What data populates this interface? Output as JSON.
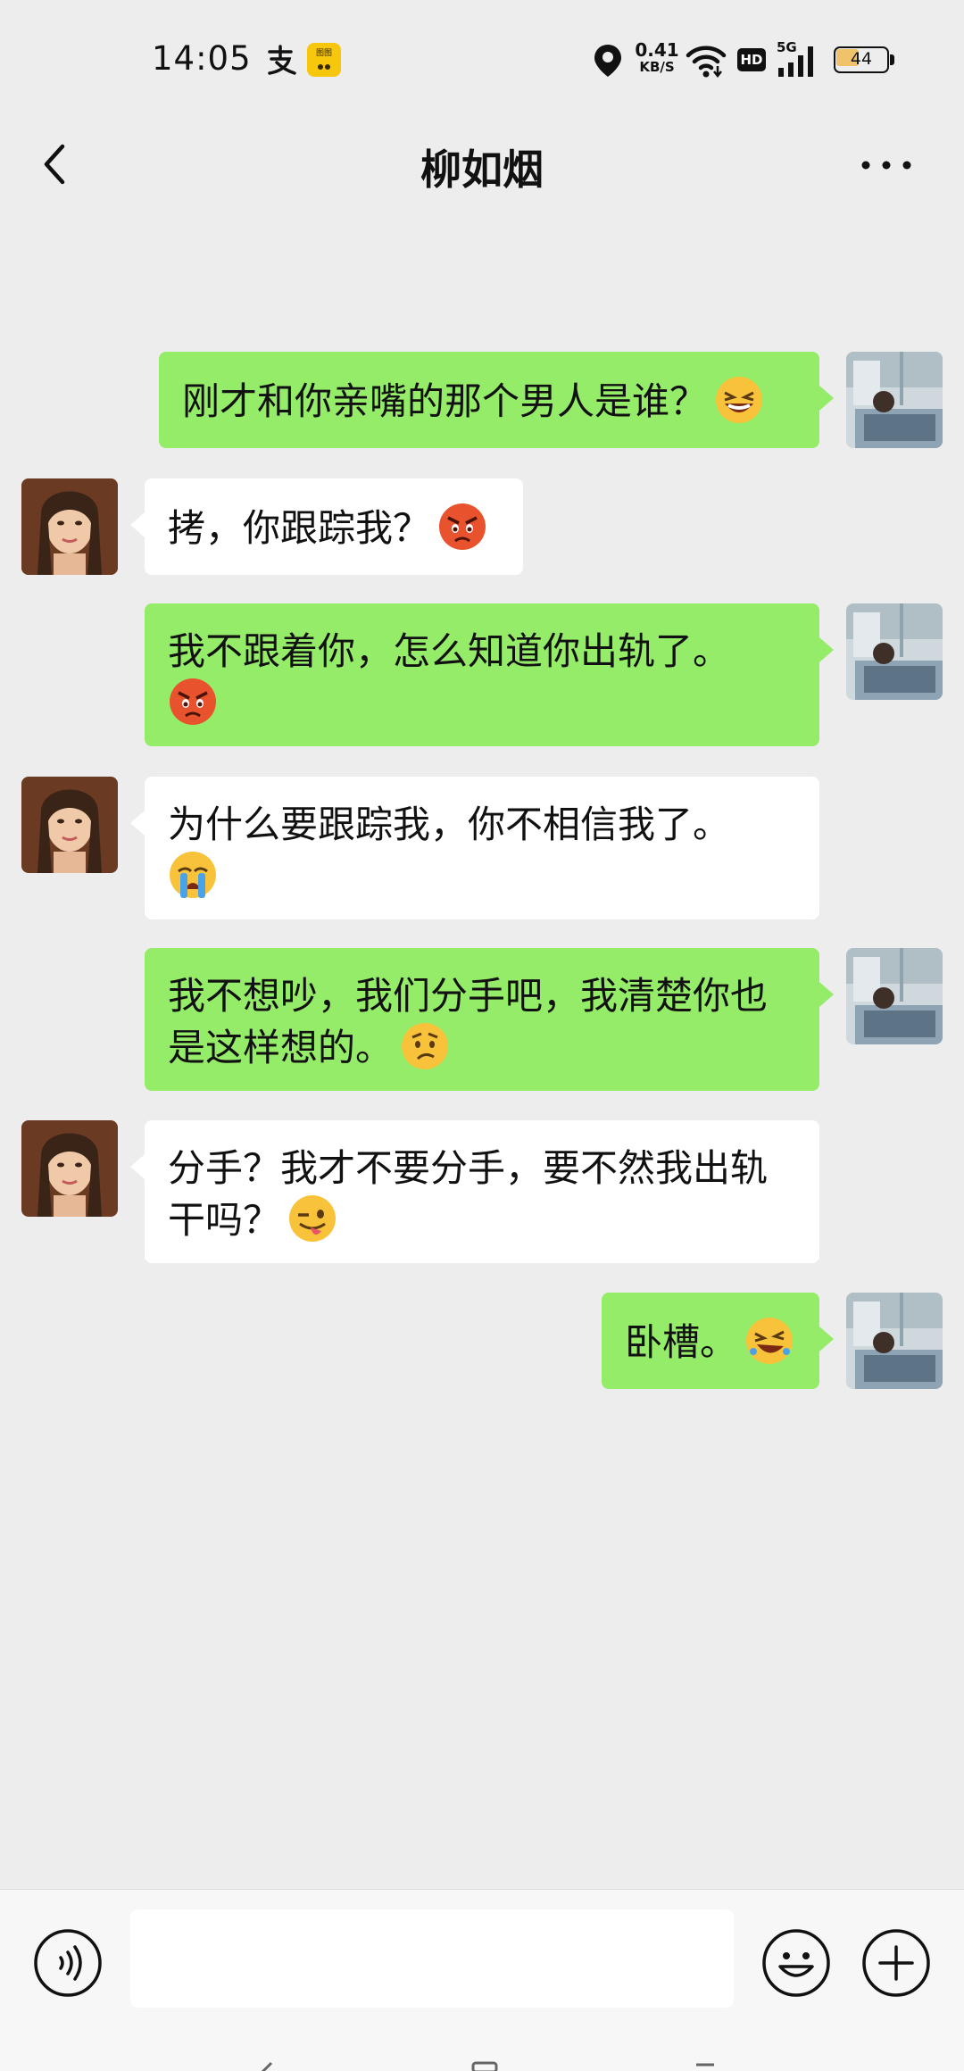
{
  "status_bar": {
    "time": "14:05",
    "app_badge_text": "图图",
    "net_speed_value": "0.41",
    "net_speed_unit": "KB/S",
    "hd_label": "HD",
    "signal_label": "5G",
    "battery_level": "44",
    "battery_fraction": 0.44,
    "icons": [
      "alipay-icon",
      "app-badge-icon",
      "location-icon",
      "wifi-icon",
      "hd-icon",
      "signal-icon",
      "battery-icon"
    ]
  },
  "header": {
    "title": "柳如烟",
    "icons": [
      "back-icon",
      "more-icon"
    ]
  },
  "messages": [
    {
      "side": "out",
      "text": "刚才和你亲嘴的那个男人是谁？",
      "emoji": "grinning-squint-emoji"
    },
    {
      "side": "in",
      "text": "拷，你跟踪我？",
      "emoji": "angry-emoji"
    },
    {
      "side": "out",
      "text": "我不跟着你，怎么知道你出轨了。",
      "emoji": "angry-emoji"
    },
    {
      "side": "in",
      "text": "为什么要跟踪我，你不相信我了。",
      "emoji": "crying-emoji"
    },
    {
      "side": "out",
      "text": "我不想吵，我们分手吧，我清楚你也是这样想的。",
      "emoji": "confused-emoji"
    },
    {
      "side": "in",
      "text": "分手？我才不要分手，要不然我出轨干吗？",
      "emoji": "wink-tongue-emoji"
    },
    {
      "side": "out",
      "text": "卧槽。",
      "emoji": "laughing-emoji"
    }
  ],
  "input_bar": {
    "placeholder": "",
    "icons": [
      "voice-icon",
      "emoji-icon",
      "plus-icon"
    ]
  },
  "colors": {
    "background": "#ededed",
    "outgoing_bubble": "#95ec69",
    "incoming_bubble": "#ffffff",
    "input_bar": "#f7f7f7"
  }
}
